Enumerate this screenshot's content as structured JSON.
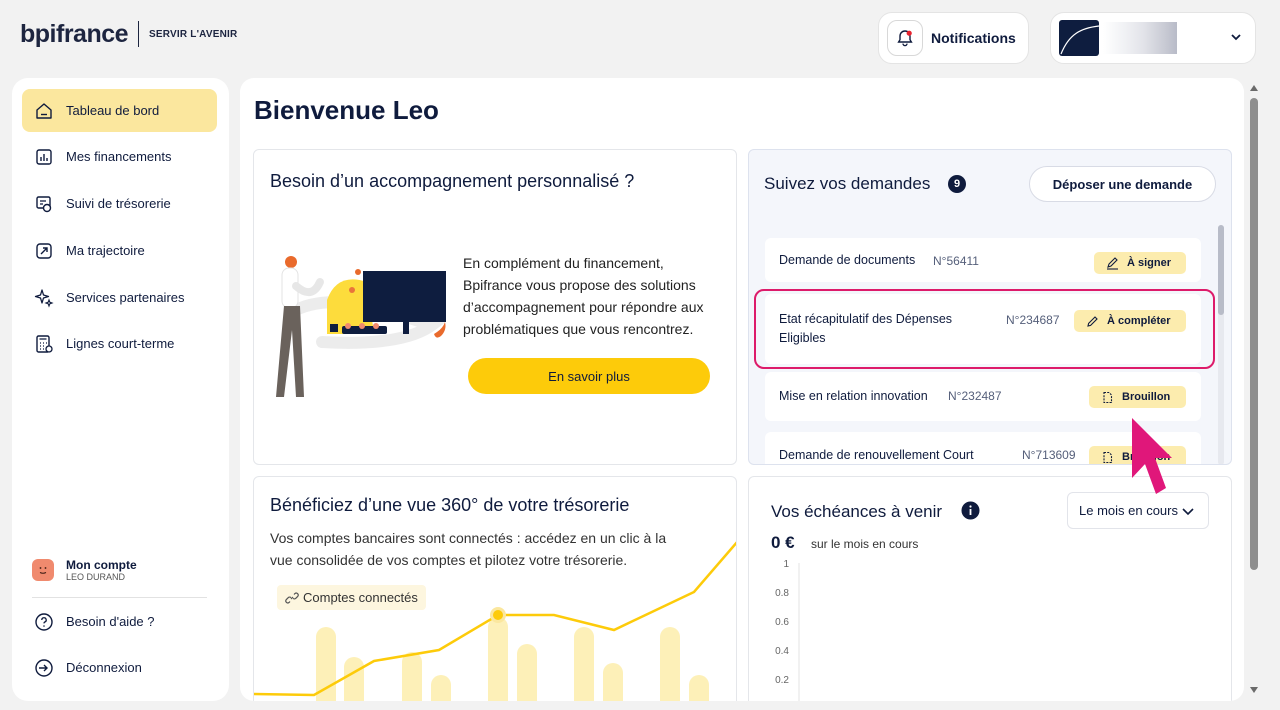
{
  "header": {
    "brand": "bpifrance",
    "tagline": "SERVIR L'AVENIR",
    "notifications_label": "Notifications"
  },
  "sidebar": {
    "items": [
      {
        "label": "Tableau de bord",
        "icon": "home-icon"
      },
      {
        "label": "Mes financements",
        "icon": "chart-icon"
      },
      {
        "label": "Suivi de trésorerie",
        "icon": "treasury-icon"
      },
      {
        "label": "Ma trajectoire",
        "icon": "trajectory-icon"
      },
      {
        "label": "Services partenaires",
        "icon": "sparkle-icon"
      },
      {
        "label": "Lignes court-terme",
        "icon": "calculator-icon"
      }
    ],
    "account": {
      "title": "Mon compte",
      "name": "LEO DURAND"
    },
    "help": "Besoin d'aide ?",
    "logout": "Déconnexion"
  },
  "main": {
    "welcome": "Bienvenue Leo",
    "accompagnement": {
      "title": "Besoin d’un accompagnement personnalisé ?",
      "text": "En complément du financement, Bpifrance vous propose des solutions d’accompagnement pour répondre aux problématiques que vous rencontrez.",
      "button": "En savoir plus"
    },
    "demandes": {
      "title": "Suivez vos demandes",
      "count": "9",
      "button": "Déposer une demande",
      "items": [
        {
          "name": "Demande de documents",
          "number": "N°56411",
          "status": "À signer"
        },
        {
          "name": "Etat récapitulatif des Dépenses Eligibles",
          "number": "N°234687",
          "status": "À compléter"
        },
        {
          "name": "Mise en relation innovation",
          "number": "N°232487",
          "status": "Brouillon"
        },
        {
          "name": "Demande de renouvellement Court",
          "number": "N°713609",
          "status": "Brouillon"
        }
      ]
    },
    "tresorerie": {
      "title": "Bénéficiez d’une vue 360° de votre trésorerie",
      "text": "Vos comptes bancaires sont connectés : accédez en un clic à la vue consolidée de vos comptes et pilotez votre trésorerie.",
      "badge": "Comptes connectés"
    },
    "echeances": {
      "title": "Vos échéances à venir",
      "filter": "Le mois en cours",
      "amount": "0 €",
      "amount_label": "sur le mois en cours",
      "yticks": [
        "1",
        "0.8",
        "0.6",
        "0.4",
        "0.2"
      ]
    }
  },
  "colors": {
    "navy": "#0f1b3d",
    "yellow": "#fdcb0a",
    "active_bg": "#fbe79e",
    "highlight": "#dd1b6a",
    "badge_bg": "#fcecae"
  }
}
